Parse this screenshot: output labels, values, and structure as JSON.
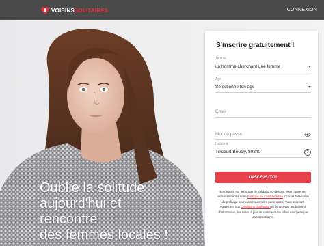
{
  "header": {
    "brand_main": "VOISINS",
    "brand_accent": "SOLITAIRES",
    "login_label": "CONNEXION"
  },
  "hero": {
    "line1": "Oublie la solitude",
    "line2": "aujourd'hui et",
    "line3": "rencontre",
    "line4": "des femmes locales !"
  },
  "form": {
    "title": "S'inscrire gratuitement !",
    "seeking_label": "Je suis",
    "seeking_value": "un homme cherchant une femme",
    "age_label": "Âge",
    "age_value": "Sélectionne ton âge",
    "email_placeholder": "Email",
    "password_placeholder": "Mot de passe",
    "location_label": "Habite à",
    "location_value": "Tincourt-Boucly, 80240",
    "submit_label": "INSCRIS-TOI",
    "legal_part1": "En cliquant sur le bouton de validation ci-dessus, vous consentez expressément à notre",
    "privacy_link": "Politique de Confidentialité",
    "legal_part2": "incluant l'utilisation du profilage pour vous trouver des partenaires. Vous acceptez également nos",
    "terms_link": "Conditions d'utilisation",
    "legal_part3": "et de recevoir les bulletins d'information, les mises à jour de compte et les offres envoyées par VoisinsSolitaires."
  },
  "colors": {
    "brand_red": "#e8303a",
    "topbar": "#4a4a4a",
    "cta": "#e8414b"
  },
  "icons": {
    "password_toggle": "eye-icon",
    "location_help": "help-icon",
    "dropdown": "caret-down-icon"
  }
}
